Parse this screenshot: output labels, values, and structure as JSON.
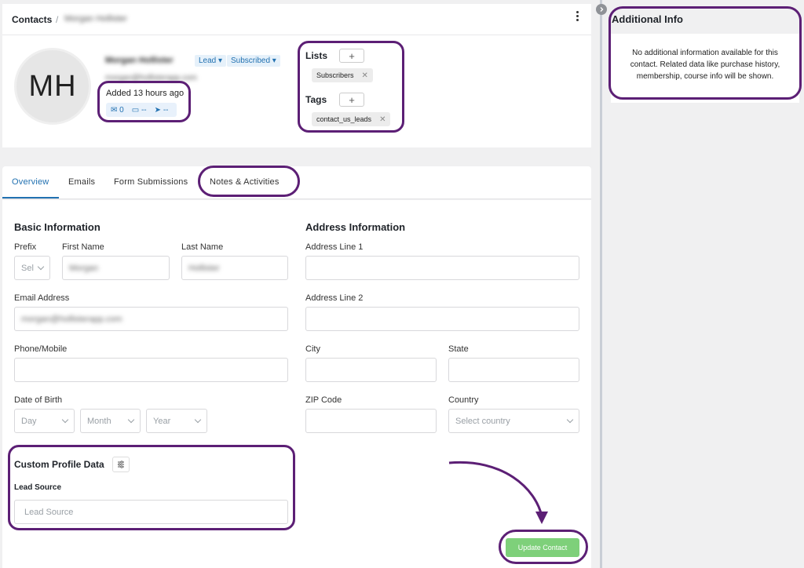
{
  "header": {
    "breadcrumb_root": "Contacts",
    "breadcrumb_sep": "/",
    "contact_name": "Morgan Hollister"
  },
  "profile": {
    "initials": "MH",
    "name": "Morgan Hollister",
    "email": "morgan@hollisterapp.com",
    "status_badge": "Lead",
    "subscription_badge": "Subscribed",
    "added": "Added 13 hours ago",
    "stats": {
      "emails": "0",
      "folder": "--",
      "sent": "--"
    }
  },
  "lists": {
    "title": "Lists",
    "add": "+",
    "items": [
      "Subscribers"
    ]
  },
  "tags": {
    "title": "Tags",
    "add": "+",
    "items": [
      "contact_us_leads"
    ]
  },
  "tabs": [
    "Overview",
    "Emails",
    "Form Submissions",
    "Notes & Activities"
  ],
  "basic": {
    "title": "Basic Information",
    "prefix_label": "Prefix",
    "prefix_value": "Sel",
    "first_label": "First Name",
    "first_value": "Morgan",
    "last_label": "Last Name",
    "last_value": "Hollister",
    "email_label": "Email Address",
    "email_value": "morgan@hollisterapp.com",
    "phone_label": "Phone/Mobile",
    "dob_label": "Date of Birth",
    "day": "Day",
    "month": "Month",
    "year": "Year"
  },
  "address": {
    "title": "Address Information",
    "line1_label": "Address Line 1",
    "line2_label": "Address Line 2",
    "city_label": "City",
    "state_label": "State",
    "zip_label": "ZIP Code",
    "country_label": "Country",
    "country_placeholder": "Select country"
  },
  "custom": {
    "title": "Custom Profile Data",
    "lead_label": "Lead Source",
    "lead_placeholder": "Lead Source"
  },
  "actions": {
    "update": "Update Contact"
  },
  "sidebar": {
    "title": "Additional Info",
    "empty_text": "No additional information available for this contact. Related data like purchase history, membership, course info will be shown."
  },
  "colors": {
    "accent": "#2271b1",
    "annotation": "#5c1f75",
    "update_button": "#7ed07a"
  }
}
